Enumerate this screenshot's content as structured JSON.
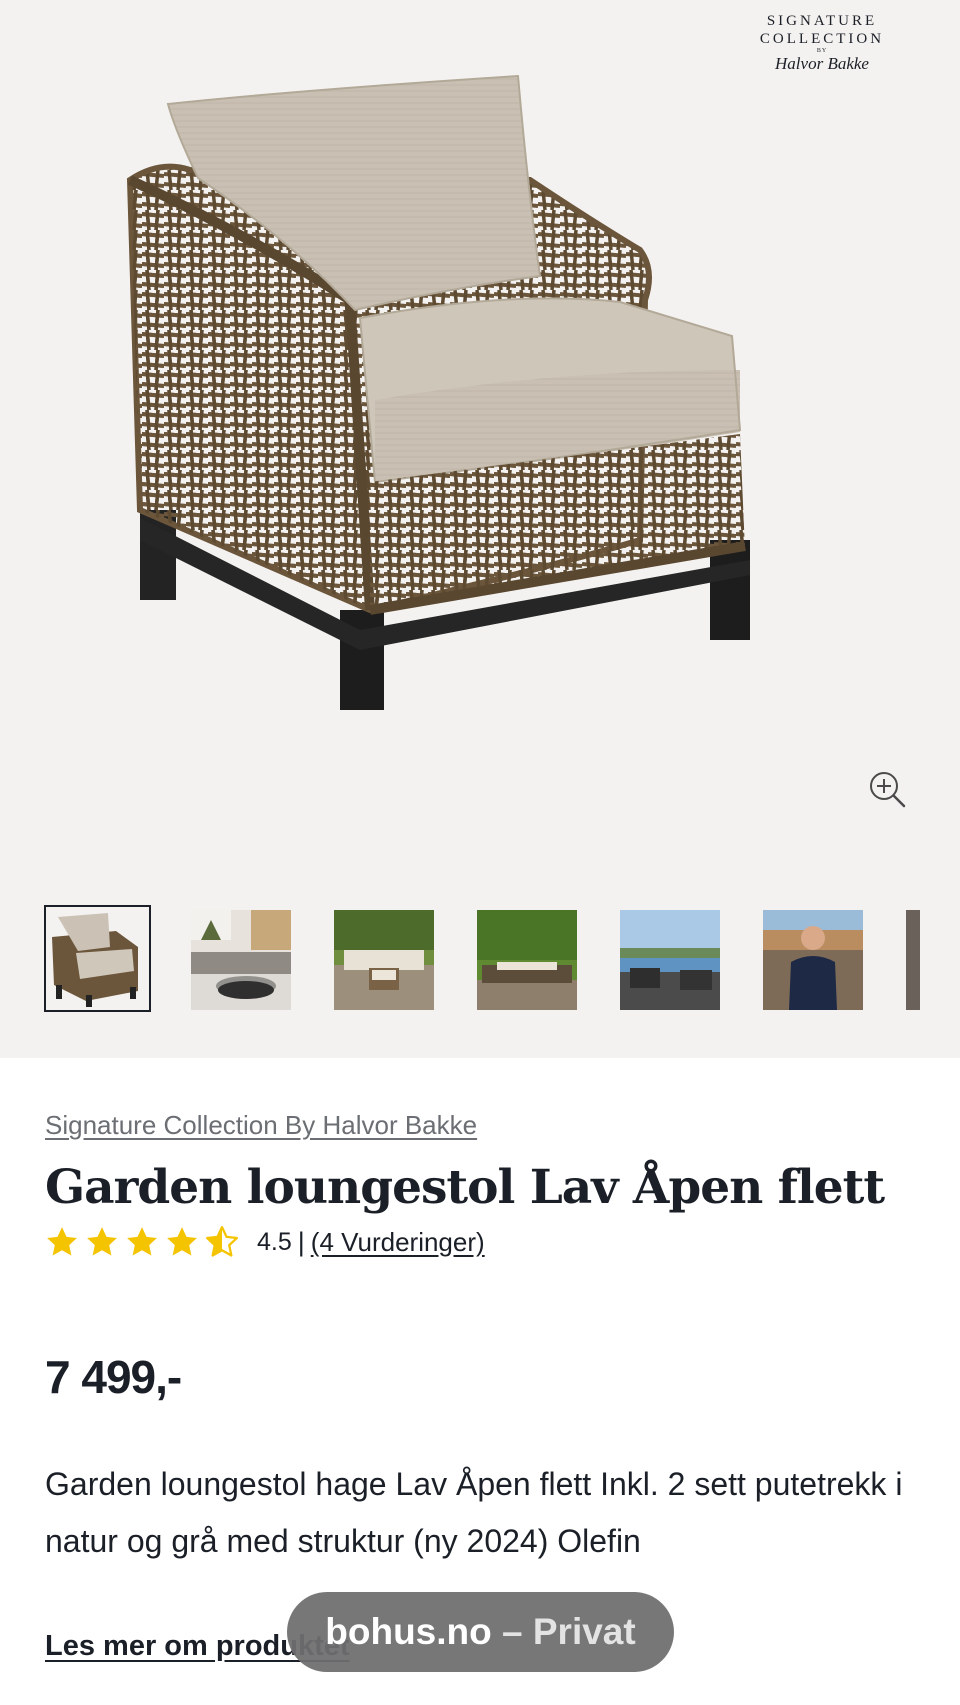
{
  "brand_logo": {
    "line1": "SIGNATURE",
    "line2": "COLLECTION",
    "line3": "BY",
    "signature": "Halvor Bakke"
  },
  "gallery": {
    "zoom_icon": "zoom-in-icon",
    "thumbnails": [
      {
        "name": "thumb-chair",
        "selected": true
      },
      {
        "name": "thumb-living-room"
      },
      {
        "name": "thumb-garden-lounge"
      },
      {
        "name": "thumb-garden-hedge"
      },
      {
        "name": "thumb-sea-view"
      },
      {
        "name": "thumb-halvor-bakke"
      },
      {
        "name": "thumb-next-partial"
      }
    ]
  },
  "product": {
    "brand_link": "Signature Collection By Halvor Bakke",
    "title": "Garden loungestol Lav Åpen flett",
    "rating_value": "4.5",
    "rating_score_text": "4.5",
    "rating_separator": "|",
    "reviews_link": "(4 Vurderinger)",
    "stars_max": 5,
    "price": "7 499,-",
    "description": "Garden loungestol hage Lav Åpen flett Inkl. 2 sett putetrekk i natur og grå med struktur (ny 2024) Olefin",
    "read_more": "Les mer om produktet"
  },
  "browser_pill": {
    "domain": "bohus.no",
    "separator": " – ",
    "scope": "Privat"
  },
  "colors": {
    "hero_bg": "#f4f2f0",
    "text": "#1b1f27",
    "muted": "#6b6e73",
    "star": "#f5c400",
    "pill_bg": "#6e6e70"
  }
}
